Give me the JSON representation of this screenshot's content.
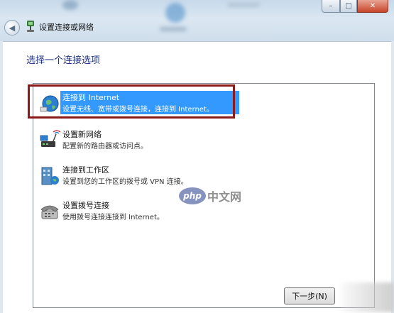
{
  "window": {
    "title": "设置连接或网络",
    "controls": {
      "minimize": "–",
      "maximize": "□",
      "close": "✕"
    }
  },
  "heading": "选择一个连接选项",
  "options": [
    {
      "title": "连接到 Internet",
      "desc": "设置无线、宽带或拨号连接，连接到 Internet。",
      "icon": "globe-icon",
      "selected": true
    },
    {
      "title": "设置新网络",
      "desc": "配置新的路由器或访问点。",
      "icon": "router-icon",
      "selected": false
    },
    {
      "title": "连接到工作区",
      "desc": "设置到您的工作区的拨号或 VPN 连接。",
      "icon": "workplace-icon",
      "selected": false
    },
    {
      "title": "设置拨号连接",
      "desc": "使用拨号连接连接到 Internet。",
      "icon": "dialup-phone-icon",
      "selected": false
    }
  ],
  "buttons": {
    "next": "下一步(N)"
  },
  "watermark": {
    "logo": "php",
    "text": "中文网"
  },
  "colors": {
    "selection": "#3399ff",
    "heading": "#1e3287",
    "highlight_frame": "#8b1a1a"
  }
}
